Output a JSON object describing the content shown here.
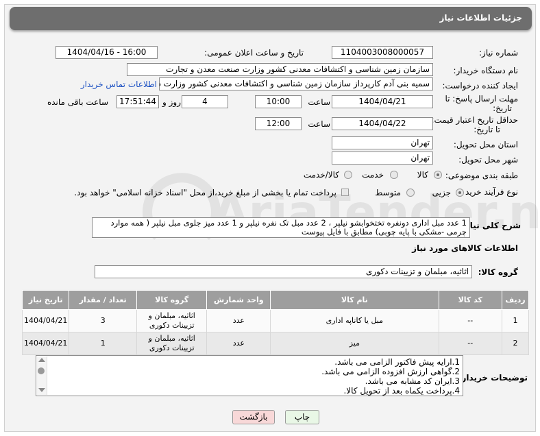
{
  "window": {
    "title": "جزئیات اطلاعات نیاز"
  },
  "watermark": {
    "text": "AriaTender.neT"
  },
  "labels": {
    "need_number": "شماره نیاز:",
    "announce_datetime": "تاریخ و ساعت اعلان عمومی:",
    "buyer_org": "نام دستگاه خریدار:",
    "requester": "ایجاد کننده درخواست:",
    "reply_deadline_1": "مهلت ارسال پاسخ: تا",
    "reply_deadline_2": "تاریخ:",
    "validity_1": "حداقل تاریخ اعتبار قیمت:",
    "validity_2": "تا تاریخ:",
    "time": "ساعت",
    "days_and": "روز و",
    "remaining": "ساعت باقی مانده",
    "province": "استان محل تحویل:",
    "city": "شهر محل تحویل:",
    "category": "طبقه بندی موضوعی:",
    "process_type": "نوع فرآیند خرید :",
    "description": "شرح کلی نیاز:",
    "goods_info": "اطلاعات کالاهای مورد نیاز",
    "goods_group": "گروه کالا:",
    "buyer_notes": "توضیحات خریدار:"
  },
  "fields": {
    "need_number": "1104003008000057",
    "announce_datetime": "1404/04/16 - 16:00",
    "buyer_org": "سازمان زمین شناسی و اکتشافات معدنی کشور وزارت صنعت معدن و تجارت",
    "requester": "سمیه بنی آدم کارپرداز سازمان زمین شناسی و اکتشافات معدنی کشور وزارت د",
    "contact_link": "اطلاعات تماس خریدار",
    "reply_date": "1404/04/21",
    "reply_time": "10:00",
    "reply_days": "4",
    "reply_remaining": "17:51:44",
    "validity_date": "1404/04/22",
    "validity_time": "12:00",
    "province": "تهران",
    "city": "تهران",
    "goods_group": "اثاثیه، مبلمان و تزیینات دکوری"
  },
  "category_options": [
    "کالا",
    "خدمت",
    "کالا/خدمت"
  ],
  "category_selected": "کالا",
  "process_options": [
    "جزیی",
    "متوسط"
  ],
  "process_selected": "جزیی",
  "payment_note": "پرداخت تمام یا بخشی از مبلغ خرید،از محل \"اسناد خزانه اسلامی\" خواهد بود.",
  "description_text": "1 عدد مبل اداری دونفره تختخوابشو نیلپر ، 2 عدد مبل تک نفره نیلپر و 1 عدد میز جلوی مبل نیلپر ( همه موارد چرمی -مشکی با پایه چوبی) مطابق با فایل پیوست",
  "table": {
    "headers": [
      "ردیف",
      "کد کالا",
      "نام کالا",
      "واحد شمارش",
      "گروه کالا",
      "تعداد / مقدار",
      "تاریخ نیاز"
    ],
    "rows": [
      [
        "1",
        "--",
        "مبل یا کاناپه اداری",
        "عدد",
        "اثاثیه، مبلمان و تزیینات دکوری",
        "3",
        "1404/04/21"
      ],
      [
        "2",
        "--",
        "میز",
        "عدد",
        "اثاثیه، مبلمان و تزیینات دکوری",
        "1",
        "1404/04/21"
      ]
    ]
  },
  "notes_lines": [
    "1.ارایه پیش فاکتور الزامی می باشد.",
    "2.گواهی ارزش افزوده الزامی می باشد.",
    "3.ایران کد مشابه می باشد.",
    "4.پرداخت یکماه بعد از تحویل کالا."
  ],
  "buttons": {
    "print": "چاپ",
    "back": "بازگشت"
  },
  "colors": {
    "title_bar": "#6e6e6e",
    "table_header": "#9e9e9e",
    "link": "#1a4fc2",
    "back_button": "#f8d8d8",
    "print_button": "#e9f7e6"
  }
}
